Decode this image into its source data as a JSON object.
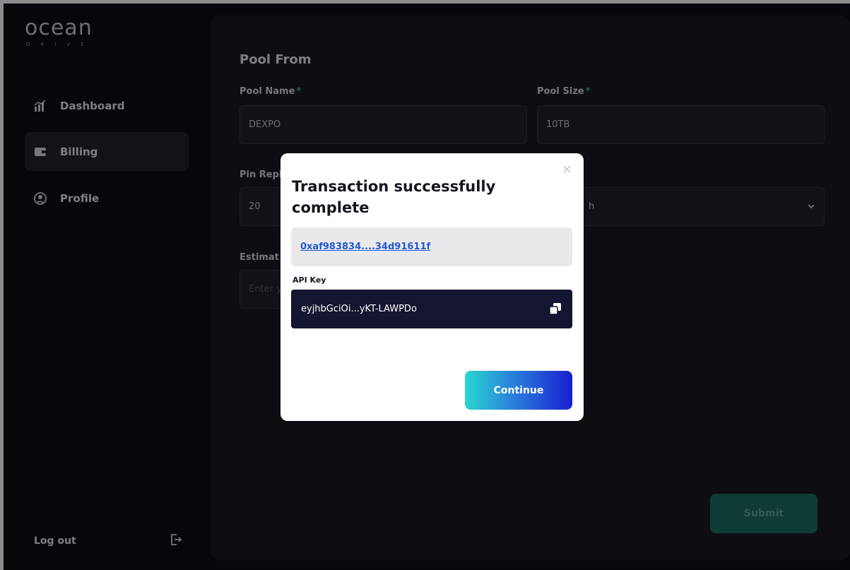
{
  "brand": {
    "name": "ocean",
    "sub": "DRIVE"
  },
  "sidebar": {
    "items": [
      {
        "label": "Dashboard",
        "icon": "chart-icon"
      },
      {
        "label": "Billing",
        "icon": "wallet-icon"
      },
      {
        "label": "Profile",
        "icon": "user-icon"
      }
    ],
    "logout_label": "Log out"
  },
  "form": {
    "title": "Pool From",
    "pool_name_label": "Pool Name",
    "pool_name_value": "DEXPO",
    "pool_size_label": "Pool Size",
    "pool_size_value": "10TB",
    "pin_label_partial": "Pin Repl",
    "pin_value": "20",
    "select_value_partial": "h",
    "estimate_label_partial": "Estimat",
    "estimate_placeholder_partial": "Enter y",
    "required_mark": "*",
    "submit_label": "Submit"
  },
  "modal": {
    "title": "Transaction successfully complete",
    "tx_hash": "0xaf983834....34d91611f",
    "api_key_label": "API Key",
    "api_key_value": "eyjhbGciOi...yKT-LAWPDo",
    "continue_label": "Continue",
    "close_symbol": "×"
  },
  "colors": {
    "accent_teal": "#2bb99a",
    "submit_bg": "#1a6c60",
    "link_blue": "#2359d6",
    "api_box": "#141530"
  }
}
